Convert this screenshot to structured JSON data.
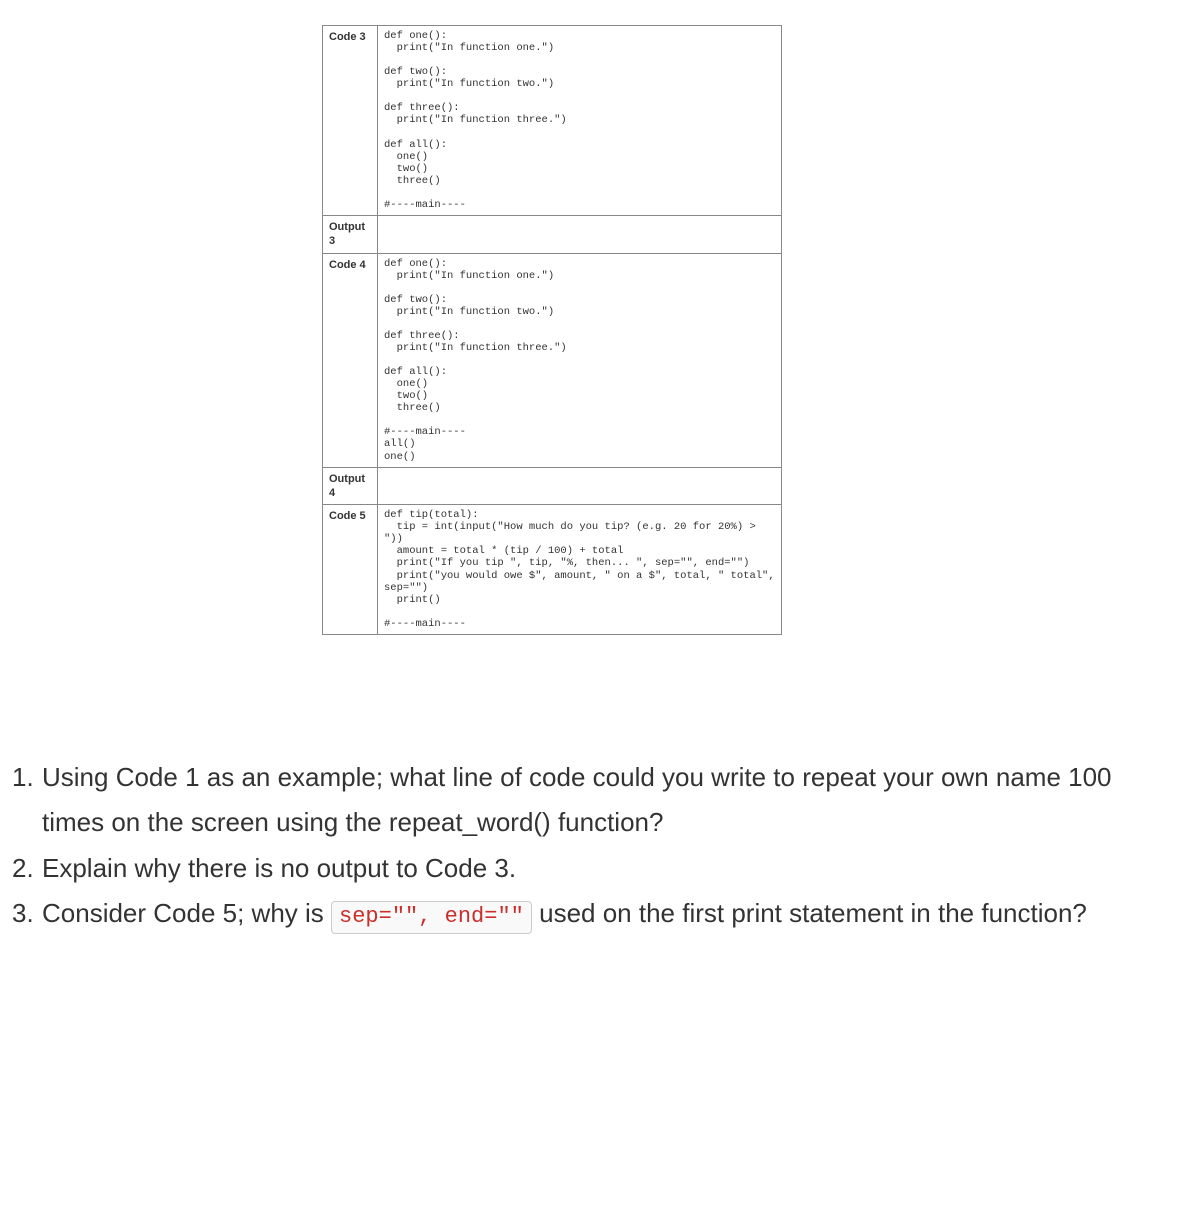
{
  "rows": [
    {
      "label": "Code 3",
      "code": "def one():\n  print(\"In function one.\")\n \ndef two():\n  print(\"In function two.\")\n \ndef three():\n  print(\"In function three.\")\n \ndef all():\n  one()\n  two()\n  three()\n \n#----main----"
    },
    {
      "label": "Output 3",
      "code": ""
    },
    {
      "label": "Code 4",
      "code": "def one():\n  print(\"In function one.\")\n \ndef two():\n  print(\"In function two.\")\n \ndef three():\n  print(\"In function three.\")\n \ndef all():\n  one()\n  two()\n  three()\n \n#----main----\nall()\none()"
    },
    {
      "label": "Output 4",
      "code": ""
    },
    {
      "label": "Code 5",
      "code": "def tip(total):\n  tip = int(input(\"How much do you tip? (e.g. 20 for 20%) >\n\"))\n  amount = total * (tip / 100) + total\n  print(\"If you tip \", tip, \"%, then... \", sep=\"\", end=\"\")\n  print(\"you would owe $\", amount, \" on a $\", total, \" total\",\nsep=\"\")\n  print()\n \n#----main----"
    }
  ],
  "questions": {
    "q1_a": "Using Code 1 as an example; what line of code could you write to repeat your own name 100 times on the screen using the repeat_word() function?",
    "q2_a": "Explain why there is no output to Code 3.",
    "q3_a": "Consider Code 5; why is ",
    "q3_code": "sep=\"\", end=\"\"",
    "q3_b": " used on the first print statement in the function?"
  }
}
